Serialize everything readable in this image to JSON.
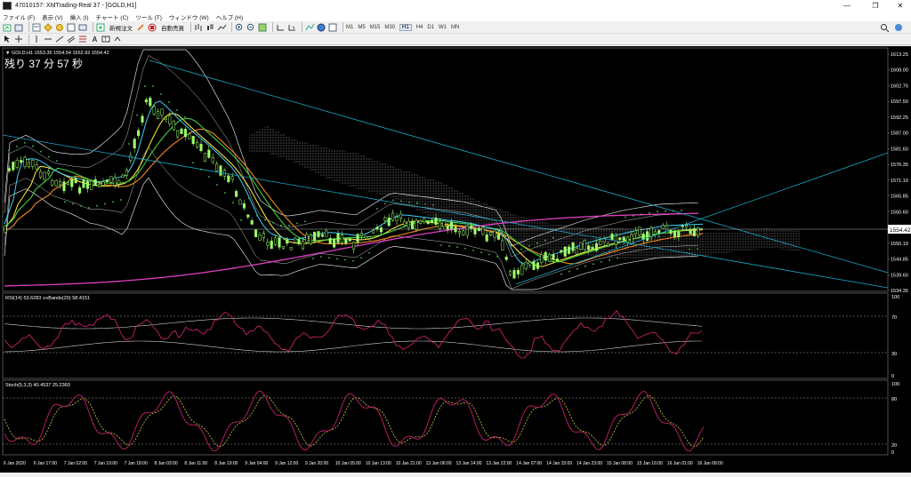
{
  "window": {
    "title": "47010157: XMTrading-Real 37 - [GOLD,H1]",
    "controls": [
      "—",
      "❐",
      "✕"
    ]
  },
  "menu": [
    "ファイル (F)",
    "表示 (V)",
    "挿入 (I)",
    "チャート (C)",
    "ツール (T)",
    "ウィンドウ (W)",
    "ヘルプ (H)"
  ],
  "toolbar": {
    "new_order_label": "新規注文",
    "auto_trade_label": "自動売買",
    "timeframes": [
      "M1",
      "M5",
      "M15",
      "M30",
      "H1",
      "H4",
      "D1",
      "W1",
      "MN"
    ],
    "active_timeframe": "H1"
  },
  "chart": {
    "symbol_info": "▼ GOLD,H1  1553.35 1554.54 1552.92 1554.42",
    "countdown": "残り 37 分 57 秒",
    "current_price": "1554.42",
    "price_ticks": [
      "1613.25",
      "1608.00",
      "1602.75",
      "1597.50",
      "1592.25",
      "1587.00",
      "1581.60",
      "1576.35",
      "1571.10",
      "1565.85",
      "1560.60",
      "1555.35",
      "1550.10",
      "1544.85",
      "1539.60",
      "1534.35"
    ],
    "rsi_label": "RSI(14) 53.6283  ≡≡Bands(20) 58.4151",
    "rsi_ticks": [
      "100",
      "70",
      "30",
      "0"
    ],
    "stoch_label": "Stoch(5,3,3) 40.4537 25.2360",
    "stoch_ticks": [
      "100",
      "80",
      "20",
      "0"
    ],
    "time_ticks": [
      "6 Jan 2020",
      "6 Jan 17:00",
      "7 Jan 02:00",
      "7 Jan 10:00",
      "7 Jan 18:00",
      "8 Jan 03:00",
      "8 Jan 11:00",
      "8 Jan 19:00",
      "9 Jan 04:00",
      "9 Jan 12:00",
      "9 Jan 20:00",
      "10 Jan 05:00",
      "10 Jan 13:00",
      "10 Jan 21:00",
      "13 Jan 06:00",
      "13 Jan 14:00",
      "13 Jan 22:00",
      "14 Jan 07:00",
      "14 Jan 15:00",
      "14 Jan 23:00",
      "15 Jan 08:00",
      "15 Jan 16:00",
      "16 Jan 01:00",
      "16 Jan 09:00"
    ],
    "colors": {
      "background": "#000000",
      "bull": "#9dff6a",
      "bear": "#000000",
      "rsi": "#c8206a",
      "stoch_main": "#c8206a",
      "stoch_signal": "#e8e04a",
      "trendline": "#1aa8c8",
      "ma_yellow": "#f0e040",
      "ma_orange": "#f08a20",
      "ma_green": "#40d040",
      "ma_pink": "#e040c0",
      "ma_cyan": "#40d0f0"
    }
  }
}
